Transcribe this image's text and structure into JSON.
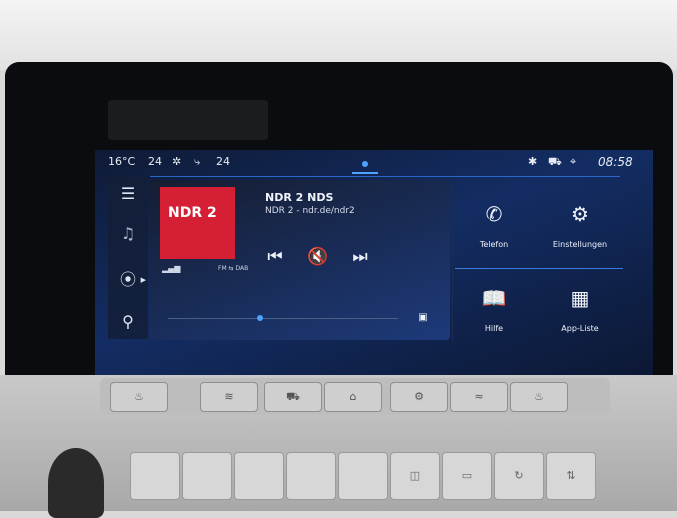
{
  "status_bar": {
    "outside_temp": "16°C",
    "left_temp": "24",
    "right_temp": "24",
    "fan_icon": "fan-icon",
    "seat_icon": "seat-heat-icon",
    "bluetooth_icon": "bluetooth-icon",
    "vehicle_icon": "car-icon",
    "location_icon": "location-icon",
    "time": "08:58"
  },
  "side_nav": [
    {
      "name": "menu",
      "icon": "menu-icon"
    },
    {
      "name": "music",
      "icon": "music-icon"
    },
    {
      "name": "radio",
      "icon": "radio-antenna-icon"
    },
    {
      "name": "search",
      "icon": "search-icon"
    }
  ],
  "media": {
    "logo_text": "NDR 2",
    "station": "NDR 2 NDS",
    "subtitle": "NDR 2 - ndr.de/ndr2",
    "band": "FM ⇆ DAB",
    "progress": 0.4
  },
  "tiles": [
    {
      "label": "Telefon",
      "icon": "phone-icon"
    },
    {
      "label": "Einstellungen",
      "icon": "gear-icon"
    },
    {
      "label": "Hilfe",
      "icon": "book-icon"
    },
    {
      "label": "App-Liste",
      "icon": "grid-icon"
    }
  ],
  "colors": {
    "accent": "#4fa3ff",
    "logo_red": "#d51f35",
    "screen_bg": "#132d63"
  }
}
